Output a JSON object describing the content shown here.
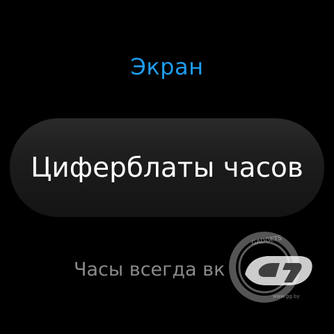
{
  "screen": {
    "title": "Экран",
    "items": [
      {
        "label": "Циферблаты часов",
        "state": "focused"
      },
      {
        "label": "Часы всегда вк",
        "state": "partially-visible"
      }
    ]
  },
  "colors": {
    "background": "#000000",
    "title": "#1e9df0",
    "focused_text": "#ffffff",
    "dim_text": "#8a8a8a"
  },
  "icons": [
    "watermark-logo-icon"
  ]
}
